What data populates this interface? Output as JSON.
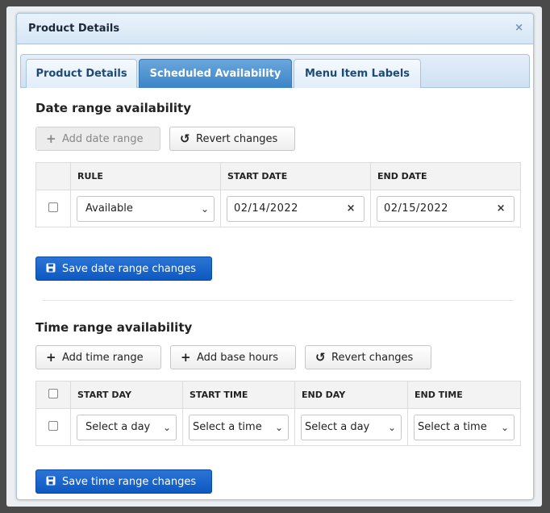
{
  "dialog": {
    "title": "Product Details",
    "close_glyph": "×"
  },
  "tabs": [
    {
      "label": "Product Details",
      "active": false
    },
    {
      "label": "Scheduled Availability",
      "active": true
    },
    {
      "label": "Menu Item Labels",
      "active": false
    }
  ],
  "date_section": {
    "heading": "Date range availability",
    "add_label": "Add date range",
    "revert_label": "Revert changes",
    "columns": [
      "RULE",
      "START DATE",
      "END DATE"
    ],
    "row": {
      "rule": "Available",
      "start_date": "02/14/2022",
      "end_date": "02/15/2022"
    },
    "save_label": "Save date range changes"
  },
  "time_section": {
    "heading": "Time range availability",
    "add_label": "Add time range",
    "base_label": "Add base hours",
    "revert_label": "Revert changes",
    "columns": [
      "START DAY",
      "START TIME",
      "END DAY",
      "END TIME"
    ],
    "row": {
      "start_day": "Select a day",
      "start_time": "Select a time",
      "end_day": "Select a day",
      "end_time": "Select a time"
    },
    "save_label": "Save time range changes"
  },
  "icons": {
    "plus": "+",
    "undo": "↺",
    "chevron": "⌄",
    "clear": "×"
  },
  "colors": {
    "primary": "#0d59c1",
    "active_tab": "#3a84c8"
  }
}
